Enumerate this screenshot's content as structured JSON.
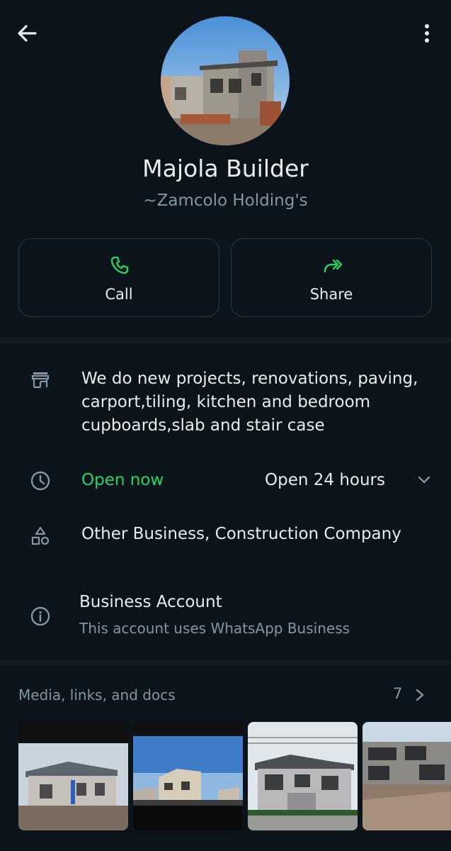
{
  "header": {
    "back_icon": "arrow-left-icon",
    "menu_icon": "more-vert-icon"
  },
  "profile": {
    "name": "Majola Builder",
    "subname": "~Zamcolo Holding's",
    "avatar_desc": "house-under-construction-photo"
  },
  "actions": [
    {
      "label": "Call",
      "icon": "phone-icon"
    },
    {
      "label": "Share",
      "icon": "share-icon"
    }
  ],
  "business": {
    "description": "We do new projects, renovations, paving, carport,tiling, kitchen and bedroom cupboards,slab and stair case",
    "status": "Open now",
    "hours": "Open 24 hours",
    "category": "Other Business, Construction Company",
    "account_title": "Business Account",
    "account_subtitle": "This account uses WhatsApp Business"
  },
  "media": {
    "title": "Media, links, and docs",
    "count": "7"
  },
  "colors": {
    "background": "#0b141a",
    "accent_green": "#25d366",
    "secondary_text": "#8696a0",
    "divider": "#111b21"
  }
}
